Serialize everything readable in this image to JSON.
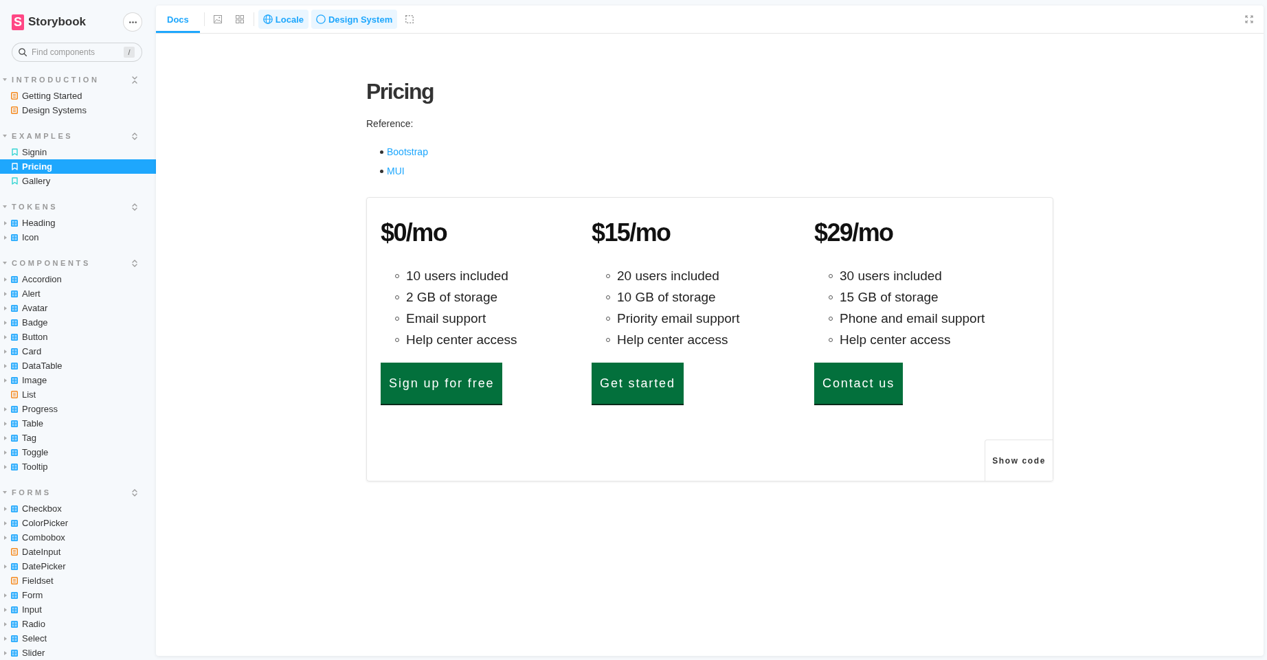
{
  "sidebar": {
    "logo": {
      "mark": "S",
      "name": "Storybook"
    },
    "search": {
      "placeholder": "Find components",
      "shortcut": "/"
    },
    "sections": [
      {
        "title": "INTRODUCTION",
        "expanded": true,
        "all_expanded": true,
        "items": [
          {
            "label": "Getting Started",
            "kind": "docs",
            "selected": false
          },
          {
            "label": "Design Systems",
            "kind": "docs",
            "selected": false
          }
        ]
      },
      {
        "title": "EXAMPLES",
        "expanded": true,
        "all_expanded": false,
        "items": [
          {
            "label": "Signin",
            "kind": "story",
            "selected": false
          },
          {
            "label": "Pricing",
            "kind": "story",
            "selected": true
          },
          {
            "label": "Gallery",
            "kind": "story",
            "selected": false
          }
        ]
      },
      {
        "title": "TOKENS",
        "expanded": true,
        "all_expanded": false,
        "items": [
          {
            "label": "Heading",
            "kind": "component",
            "expanded": false,
            "selected": false
          },
          {
            "label": "Icon",
            "kind": "component",
            "expanded": false,
            "selected": false
          }
        ]
      },
      {
        "title": "COMPONENTS",
        "expanded": true,
        "all_expanded": false,
        "items": [
          {
            "label": "Accordion",
            "kind": "component",
            "expanded": false,
            "selected": false
          },
          {
            "label": "Alert",
            "kind": "component",
            "expanded": false,
            "selected": false
          },
          {
            "label": "Avatar",
            "kind": "component",
            "expanded": false,
            "selected": false
          },
          {
            "label": "Badge",
            "kind": "component",
            "expanded": false,
            "selected": false
          },
          {
            "label": "Button",
            "kind": "component",
            "expanded": false,
            "selected": false
          },
          {
            "label": "Card",
            "kind": "component",
            "expanded": false,
            "selected": false
          },
          {
            "label": "DataTable",
            "kind": "component",
            "expanded": false,
            "selected": false
          },
          {
            "label": "Image",
            "kind": "component",
            "expanded": false,
            "selected": false
          },
          {
            "label": "List",
            "kind": "docs",
            "selected": false
          },
          {
            "label": "Progress",
            "kind": "component",
            "expanded": false,
            "selected": false
          },
          {
            "label": "Table",
            "kind": "component",
            "expanded": false,
            "selected": false
          },
          {
            "label": "Tag",
            "kind": "component",
            "expanded": false,
            "selected": false
          },
          {
            "label": "Toggle",
            "kind": "component",
            "expanded": false,
            "selected": false
          },
          {
            "label": "Tooltip",
            "kind": "component",
            "expanded": false,
            "selected": false
          }
        ]
      },
      {
        "title": "FORMS",
        "expanded": true,
        "all_expanded": false,
        "items": [
          {
            "label": "Checkbox",
            "kind": "component",
            "expanded": false,
            "selected": false
          },
          {
            "label": "ColorPicker",
            "kind": "component",
            "expanded": false,
            "selected": false
          },
          {
            "label": "Combobox",
            "kind": "component",
            "expanded": false,
            "selected": false
          },
          {
            "label": "DateInput",
            "kind": "docs",
            "selected": false
          },
          {
            "label": "DatePicker",
            "kind": "component",
            "expanded": false,
            "selected": false
          },
          {
            "label": "Fieldset",
            "kind": "docs",
            "selected": false
          },
          {
            "label": "Form",
            "kind": "component",
            "expanded": false,
            "selected": false
          },
          {
            "label": "Input",
            "kind": "component",
            "expanded": false,
            "selected": false
          },
          {
            "label": "Radio",
            "kind": "component",
            "expanded": false,
            "selected": false
          },
          {
            "label": "Select",
            "kind": "component",
            "expanded": false,
            "selected": false
          },
          {
            "label": "Slider",
            "kind": "component",
            "expanded": false,
            "selected": false
          }
        ]
      }
    ]
  },
  "toolbar": {
    "tabs": [
      {
        "label": "Docs",
        "selected": true
      }
    ],
    "tools": [
      {
        "label": "Locale",
        "kind": "globe",
        "active": true
      },
      {
        "label": "Design System",
        "kind": "circle",
        "active": true
      }
    ]
  },
  "docs": {
    "title": "Pricing",
    "intro": "Reference:",
    "links": [
      "Bootstrap",
      "MUI"
    ],
    "preview": {
      "plans": [
        {
          "price": "$0/mo",
          "features": [
            "10 users included",
            "2 GB of storage",
            "Email support",
            "Help center access"
          ],
          "button": "Sign up for free"
        },
        {
          "price": "$15/mo",
          "features": [
            "20 users included",
            "10 GB of storage",
            "Priority email support",
            "Help center access"
          ],
          "button": "Get started"
        },
        {
          "price": "$29/mo",
          "features": [
            "30 users included",
            "15 GB of storage",
            "Phone and email support",
            "Help center access"
          ],
          "button": "Contact us"
        }
      ],
      "show_code": "Show code"
    }
  }
}
